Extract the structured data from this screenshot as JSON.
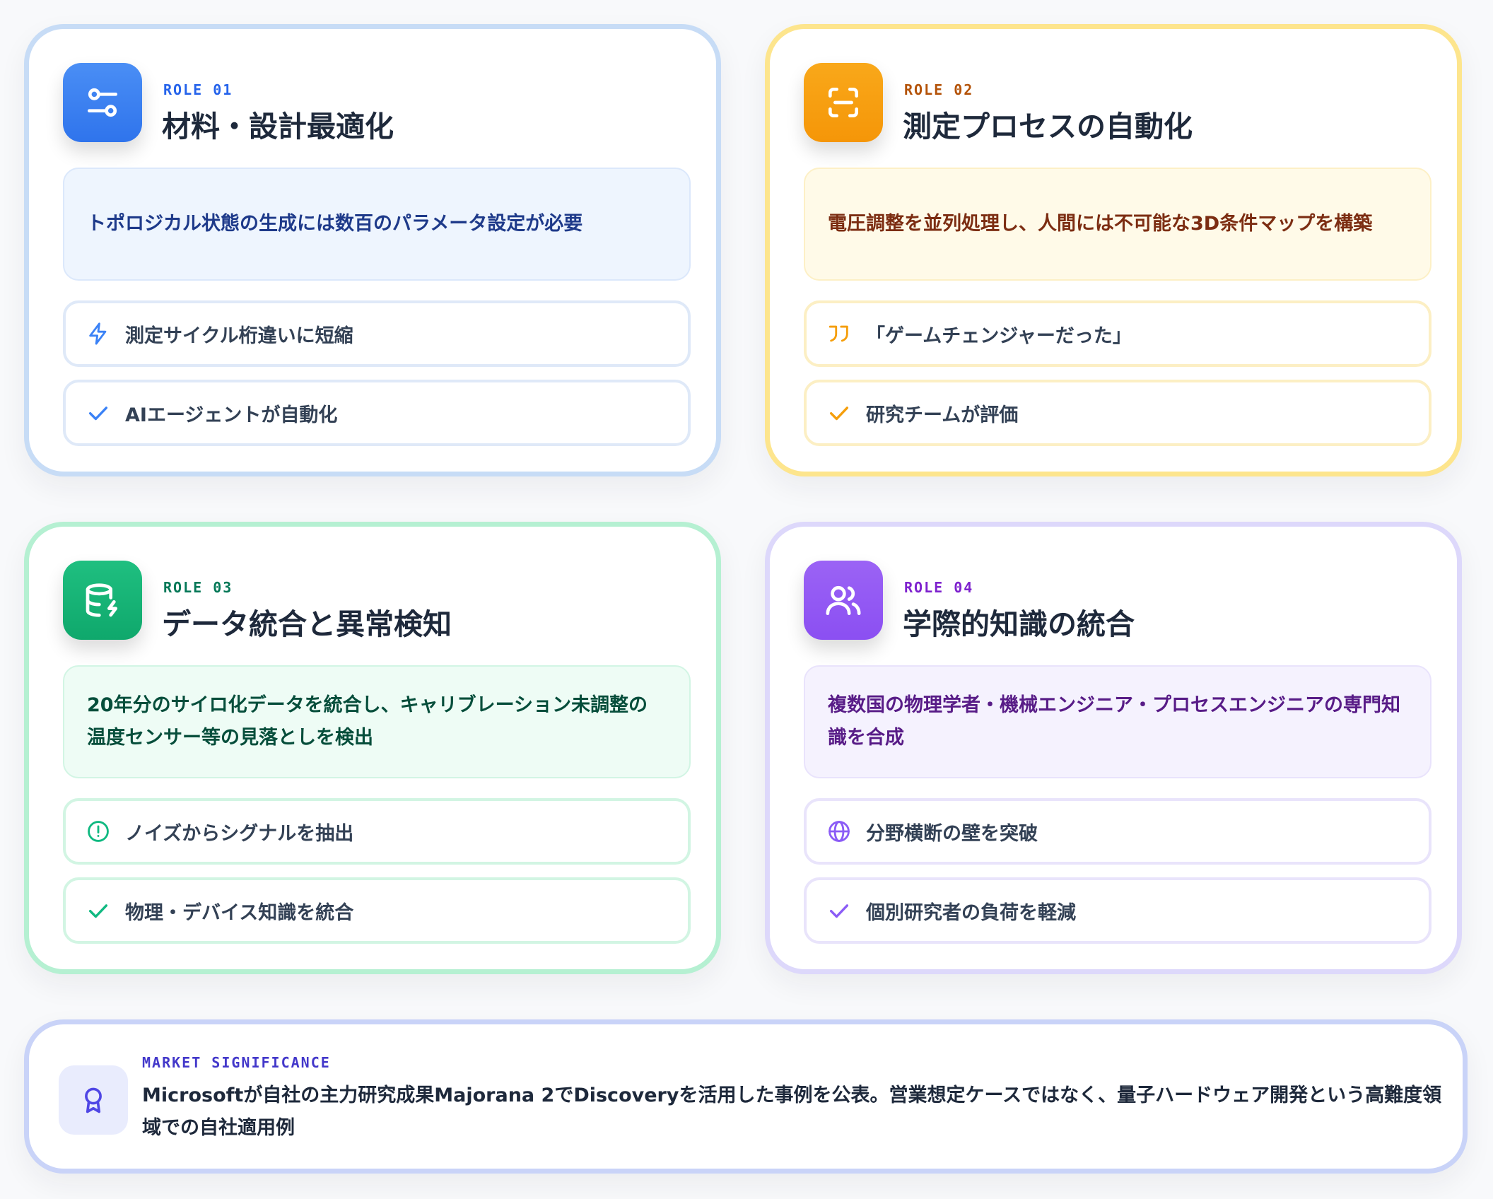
{
  "cards": [
    {
      "role": "ROLE 01",
      "title": "材料・設計最適化",
      "description": "トポロジカル状態の生成には数百のパラメータ設定が必要",
      "items": [
        {
          "icon": "lightning-icon",
          "label": "測定サイクル桁違いに短縮"
        },
        {
          "icon": "check-icon",
          "label": "AIエージェントが自動化"
        }
      ],
      "icon": "sliders-icon",
      "accent": "#3b82f6"
    },
    {
      "role": "ROLE 02",
      "title": "測定プロセスの自動化",
      "description": "電圧調整を並列処理し、人間には不可能な3D条件マップを構築",
      "items": [
        {
          "icon": "quote-icon",
          "label": "「ゲームチェンジャーだった」"
        },
        {
          "icon": "check-icon",
          "label": "研究チームが評価"
        }
      ],
      "icon": "scan-icon",
      "accent": "#f59e0b"
    },
    {
      "role": "ROLE 03",
      "title": "データ統合と異常検知",
      "description": "20年分のサイロ化データを統合し、キャリブレーション未調整の温度センサー等の見落としを検出",
      "items": [
        {
          "icon": "alert-circle-icon",
          "label": "ノイズからシグナルを抽出"
        },
        {
          "icon": "check-icon",
          "label": "物理・デバイス知識を統合"
        }
      ],
      "icon": "database-bolt-icon",
      "accent": "#10b981"
    },
    {
      "role": "ROLE 04",
      "title": "学際的知識の統合",
      "description": "複数国の物理学者・機械エンジニア・プロセスエンジニアの専門知識を合成",
      "items": [
        {
          "icon": "globe-icon",
          "label": "分野横断の壁を突破"
        },
        {
          "icon": "check-icon",
          "label": "個別研究者の負荷を軽減"
        }
      ],
      "icon": "users-icon",
      "accent": "#8b5cf6"
    }
  ],
  "market": {
    "tag": "MARKET SIGNIFICANCE",
    "text": "Microsoftが自社の主力研究成果Majorana 2でDiscoveryを活用した事例を公表。営業想定ケースではなく、量子ハードウェア開発という高難度領域での自社適用例",
    "icon": "award-icon"
  }
}
